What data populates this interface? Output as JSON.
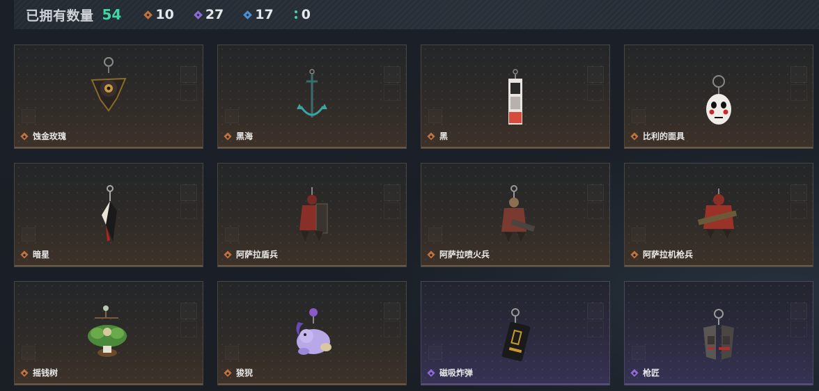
{
  "header": {
    "title": "已拥有数量",
    "total": "54",
    "stats": [
      {
        "icon": "orange-diamond-icon",
        "color": "#c0723c",
        "count": "10"
      },
      {
        "icon": "purple-diamond-icon",
        "color": "#8e6ad6",
        "count": "27"
      },
      {
        "icon": "blue-diamond-icon",
        "color": "#4d8fd6",
        "count": "17"
      },
      {
        "icon": "green-dots-icon",
        "color": "#3fd7a4",
        "count": "0"
      }
    ]
  },
  "items": [
    {
      "name": "蚀金玫瑰",
      "tier": "orange",
      "art": "black-rose-charm-icon"
    },
    {
      "name": "黑海",
      "tier": "orange",
      "art": "anchor-charm-icon"
    },
    {
      "name": "黑",
      "tier": "orange",
      "art": "card-charm-icon"
    },
    {
      "name": "比利的面具",
      "tier": "orange",
      "art": "billy-mask-charm-icon"
    },
    {
      "name": "暗星",
      "tier": "orange",
      "art": "dark-star-blade-charm-icon"
    },
    {
      "name": "阿萨拉盾兵",
      "tier": "orange",
      "art": "asala-shield-soldier-charm-icon"
    },
    {
      "name": "阿萨拉喷火兵",
      "tier": "orange",
      "art": "asala-flamethrower-charm-icon"
    },
    {
      "name": "阿萨拉机枪兵",
      "tier": "orange",
      "art": "asala-machinegunner-charm-icon"
    },
    {
      "name": "摇钱树",
      "tier": "orange",
      "art": "money-tree-charm-icon"
    },
    {
      "name": "狻猊",
      "tier": "orange",
      "art": "suanni-lion-charm-icon"
    },
    {
      "name": "磁吸炸弹",
      "tier": "purple",
      "art": "magnetic-bomb-charm-icon"
    },
    {
      "name": "枪匠",
      "tier": "purple",
      "art": "gunsmith-vest-charm-icon"
    }
  ]
}
